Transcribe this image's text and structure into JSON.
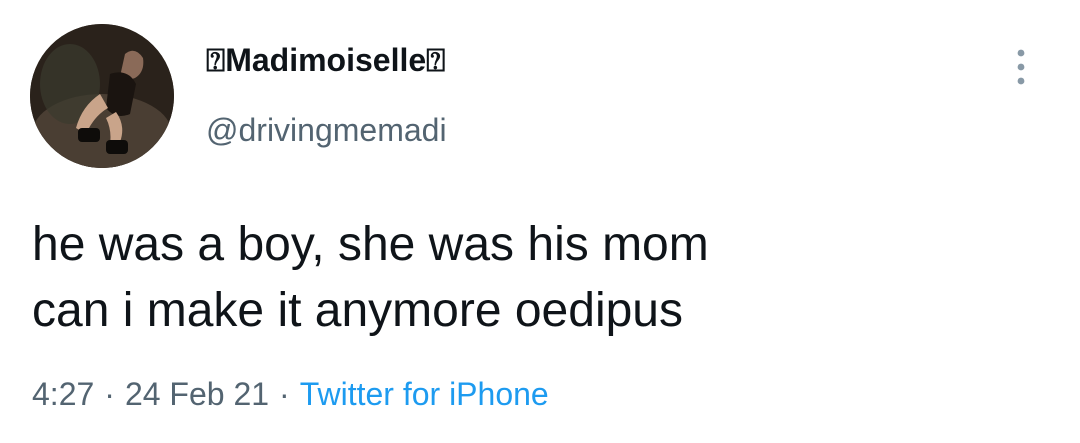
{
  "tweet": {
    "display_name": "⍰Madimoiselle⍰",
    "handle": "@drivingmemadi",
    "text_lines": [
      "he was a boy, she was his mom",
      "can i make it anymore oedipus"
    ],
    "time": "4:27",
    "separator": "·",
    "date": "24 Feb 21",
    "source": "Twitter for iPhone"
  },
  "icons": {
    "avatar": "profile-photo",
    "more": "more-vertical-icon"
  },
  "colors": {
    "text_primary": "#0f1419",
    "text_secondary": "#536471",
    "link": "#1d9bf0"
  }
}
